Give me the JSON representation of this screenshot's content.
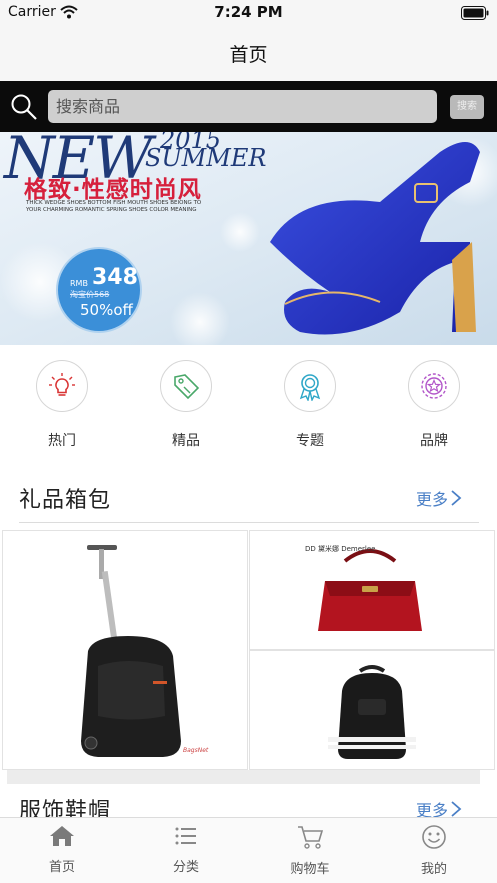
{
  "status_bar": {
    "carrier": "Carrier",
    "time": "7:24 PM"
  },
  "nav": {
    "title": "首页"
  },
  "search": {
    "placeholder": "搜索商品",
    "button_label": "搜索"
  },
  "banner": {
    "headline_new": "NEW",
    "headline_year": "2015",
    "headline_summer": "SUMMER",
    "slogan": "格致·性感时尚风",
    "subtext_line1": "THICK WEDGE SHOES BOTTOM FISH MOUTH SHOES BEIONG TO",
    "subtext_line2": "YOUR CHARMING ROMANTIC SPRING SHOES COLOR MEANING",
    "currency": "RMB",
    "price": "348",
    "original_price": "淘宝价568",
    "discount": "50%off"
  },
  "categories": [
    {
      "label": "热门",
      "icon": "lightbulb-icon"
    },
    {
      "label": "精品",
      "icon": "tag-icon"
    },
    {
      "label": "专题",
      "icon": "ribbon-badge-icon"
    },
    {
      "label": "品牌",
      "icon": "star-badge-icon"
    }
  ],
  "sections": [
    {
      "title": "礼品箱包",
      "more": "更多"
    },
    {
      "title": "服饰鞋帽",
      "more": "更多"
    }
  ],
  "products": {
    "big": {
      "name": "trolley backpack",
      "watermark": "BagsNet"
    },
    "top_right": {
      "brand": "DD 黛米娜 Demerlee"
    },
    "bottom_right": {
      "name": "black backpack"
    }
  },
  "tabs": [
    {
      "label": "首页",
      "icon": "home-icon"
    },
    {
      "label": "分类",
      "icon": "list-icon"
    },
    {
      "label": "购物车",
      "icon": "cart-icon"
    },
    {
      "label": "我的",
      "icon": "smiley-icon"
    }
  ],
  "colors": {
    "accent_blue": "#4a7fc6",
    "search_bar_bg": "#0b0b0b",
    "price_circle": "#3b8fd8",
    "slogan_red": "#d6203c",
    "shoe_blue": "#2433c8"
  }
}
